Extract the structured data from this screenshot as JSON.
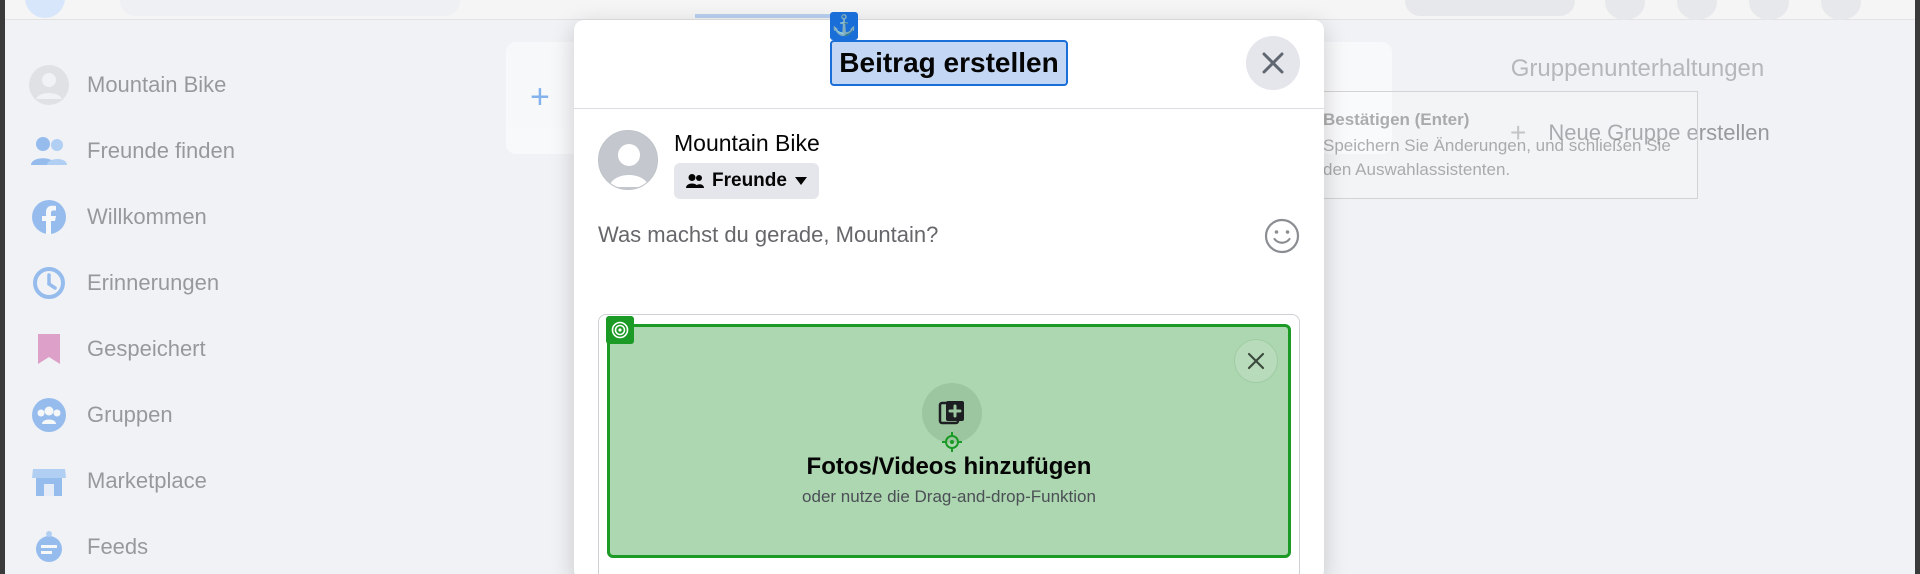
{
  "sidebar": {
    "items": [
      {
        "label": "Mountain Bike",
        "icon": "profile-avatar-icon"
      },
      {
        "label": "Freunde finden",
        "icon": "friends-icon"
      },
      {
        "label": "Willkommen",
        "icon": "facebook-icon"
      },
      {
        "label": "Erinnerungen",
        "icon": "clock-history-icon"
      },
      {
        "label": "Gespeichert",
        "icon": "bookmark-icon"
      },
      {
        "label": "Gruppen",
        "icon": "groups-icon"
      },
      {
        "label": "Marketplace",
        "icon": "shop-icon"
      },
      {
        "label": "Feeds",
        "icon": "feeds-icon"
      }
    ]
  },
  "right_panel": {
    "title": "Gruppenunterhaltungen",
    "new_group_label": "Neue Gruppe erstellen"
  },
  "tooltip": {
    "title": "Bestätigen (Enter)",
    "description": "Speichern Sie Änderungen, und schließen Sie den Auswahlassistenten."
  },
  "modal": {
    "title": "Beitrag erstellen",
    "user_name": "Mountain Bike",
    "audience": "Freunde",
    "composer_placeholder": "Was machst du gerade, Mountain?",
    "media": {
      "title": "Fotos/Videos hinzufügen",
      "subtitle": "oder nutze die Drag-and-drop-Funktion"
    }
  },
  "colors": {
    "accent": "#1a6ed8",
    "highlight_green": "#1b9a25",
    "green_fill": "#add7b0"
  }
}
